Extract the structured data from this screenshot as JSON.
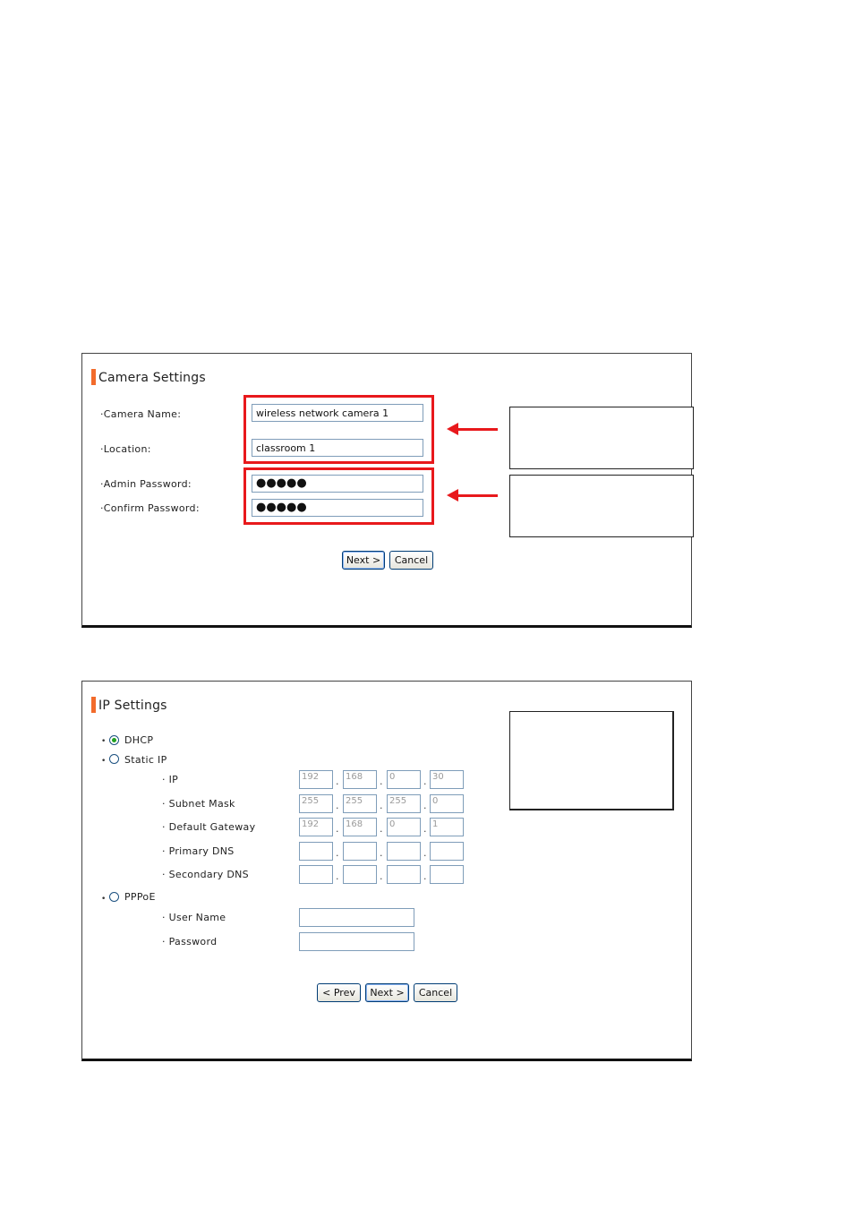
{
  "camera_settings": {
    "title": "Camera Settings",
    "camera_name_label": "·Camera Name:",
    "camera_name_value": "wireless network camera 1",
    "location_label": "·Location:",
    "location_value": "classroom 1",
    "admin_password_label": "·Admin Password:",
    "admin_password_value": "●●●●●",
    "confirm_password_label": "·Confirm Password:",
    "confirm_password_value": "●●●●●",
    "next_label": "Next >",
    "cancel_label": "Cancel"
  },
  "ip_settings": {
    "title": "IP Settings",
    "dhcp_label": "DHCP",
    "dhcp_selected": true,
    "static_ip_label": "Static IP",
    "ip_label": "· IP",
    "ip": [
      "192",
      "168",
      "0",
      "30"
    ],
    "subnet_mask_label": "· Subnet Mask",
    "subnet_mask": [
      "255",
      "255",
      "255",
      "0"
    ],
    "default_gateway_label": "· Default Gateway",
    "default_gateway": [
      "192",
      "168",
      "0",
      "1"
    ],
    "primary_dns_label": "· Primary DNS",
    "primary_dns": [
      "",
      "",
      "",
      ""
    ],
    "secondary_dns_label": "· Secondary DNS",
    "secondary_dns": [
      "",
      "",
      "",
      ""
    ],
    "pppoe_label": "PPPoE",
    "user_name_label": "· User Name",
    "password_label": "· Password",
    "prev_label": "< Prev",
    "next_label": "Next >",
    "cancel_label": "Cancel"
  },
  "colors": {
    "highlight": "#e8191c",
    "title_accent": "#f26b2b",
    "input_border": "#7f9db9"
  }
}
